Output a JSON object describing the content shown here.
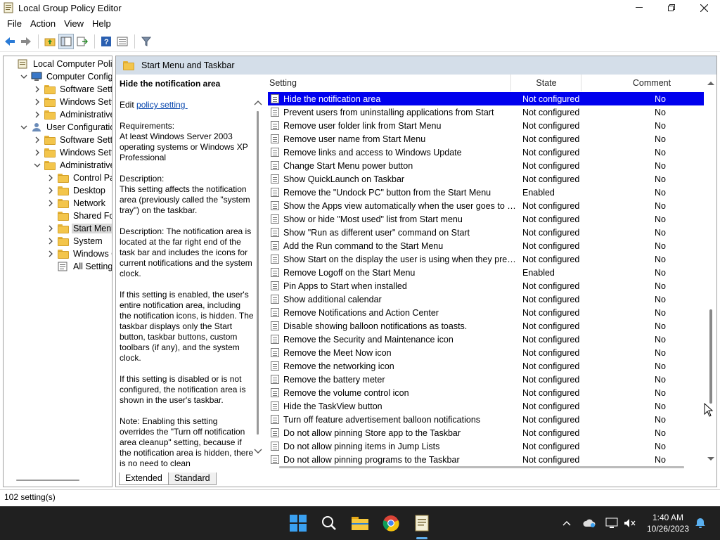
{
  "window": {
    "title": "Local Group Policy Editor"
  },
  "menu": [
    "File",
    "Action",
    "View",
    "Help"
  ],
  "tree": [
    {
      "label": "Local Computer Policy",
      "level": 0,
      "expander": "",
      "icon": "computer-policy-icon"
    },
    {
      "label": "Computer Configura",
      "level": 1,
      "expander": "open",
      "icon": "computer-icon"
    },
    {
      "label": "Software Settings",
      "level": 2,
      "expander": "closed",
      "icon": "folder-icon"
    },
    {
      "label": "Windows Setting",
      "level": 2,
      "expander": "closed",
      "icon": "folder-icon"
    },
    {
      "label": "Administrative Te",
      "level": 2,
      "expander": "closed",
      "icon": "folder-icon"
    },
    {
      "label": "User Configuration",
      "level": 1,
      "expander": "open",
      "icon": "user-icon"
    },
    {
      "label": "Software Settings",
      "level": 2,
      "expander": "closed",
      "icon": "folder-icon"
    },
    {
      "label": "Windows Setting",
      "level": 2,
      "expander": "closed",
      "icon": "folder-icon"
    },
    {
      "label": "Administrative Te",
      "level": 2,
      "expander": "open",
      "icon": "folder-icon"
    },
    {
      "label": "Control Panel",
      "level": 3,
      "expander": "closed",
      "icon": "folder-icon"
    },
    {
      "label": "Desktop",
      "level": 3,
      "expander": "closed",
      "icon": "folder-icon"
    },
    {
      "label": "Network",
      "level": 3,
      "expander": "closed",
      "icon": "folder-icon"
    },
    {
      "label": "Shared Folder",
      "level": 3,
      "expander": "",
      "icon": "folder-icon"
    },
    {
      "label": "Start Menu ar",
      "level": 3,
      "expander": "closed",
      "icon": "folder-icon",
      "selected": true
    },
    {
      "label": "System",
      "level": 3,
      "expander": "closed",
      "icon": "folder-icon"
    },
    {
      "label": "Windows Cor",
      "level": 3,
      "expander": "closed",
      "icon": "folder-icon"
    },
    {
      "label": "All Settings",
      "level": 3,
      "expander": "",
      "icon": "all-settings-icon"
    }
  ],
  "pane": {
    "title": "Start Menu and Taskbar"
  },
  "description": {
    "title": "Hide the notification area",
    "edit_prefix": "Edit ",
    "edit_link": "policy setting ",
    "paragraphs": [
      "Requirements:\nAt least Windows Server 2003 operating systems or Windows XP Professional",
      "Description:\nThis setting affects the notification area (previously called the \"system tray\") on the taskbar.",
      "Description: The notification area is located at the far right end of the task bar and includes the icons for current notifications and the system clock.",
      "If this setting is enabled, the user's entire notification area, including the notification icons, is hidden. The taskbar displays only the Start button, taskbar buttons, custom toolbars (if any), and the system clock.",
      "If this setting is disabled or is not configured, the notification area is shown in the user's taskbar.",
      "Note: Enabling this setting overrides the \"Turn off notification area cleanup\" setting, because if the notification area is hidden, there is no need to clean"
    ]
  },
  "table": {
    "headers": {
      "setting": "Setting",
      "state": "State",
      "comment": "Comment"
    },
    "rows": [
      {
        "setting": "Hide the notification area",
        "state": "Not configured",
        "comment": "No",
        "selected": true
      },
      {
        "setting": "Prevent users from uninstalling applications from Start",
        "state": "Not configured",
        "comment": "No"
      },
      {
        "setting": "Remove user folder link from Start Menu",
        "state": "Not configured",
        "comment": "No"
      },
      {
        "setting": "Remove user name from Start Menu",
        "state": "Not configured",
        "comment": "No"
      },
      {
        "setting": "Remove links and access to Windows Update",
        "state": "Not configured",
        "comment": "No"
      },
      {
        "setting": "Change Start Menu power button",
        "state": "Not configured",
        "comment": "No"
      },
      {
        "setting": "Show QuickLaunch on Taskbar",
        "state": "Not configured",
        "comment": "No"
      },
      {
        "setting": "Remove the \"Undock PC\" button from the Start Menu",
        "state": "Enabled",
        "comment": "No"
      },
      {
        "setting": "Show the Apps view automatically when the user goes to St...",
        "state": "Not configured",
        "comment": "No"
      },
      {
        "setting": "Show or hide \"Most used\" list from Start menu",
        "state": "Not configured",
        "comment": "No"
      },
      {
        "setting": "Show \"Run as different user\" command on Start",
        "state": "Not configured",
        "comment": "No"
      },
      {
        "setting": "Add the Run command to the Start Menu",
        "state": "Not configured",
        "comment": "No"
      },
      {
        "setting": "Show Start on the display the user is using when they press t...",
        "state": "Not configured",
        "comment": "No"
      },
      {
        "setting": "Remove Logoff on the Start Menu",
        "state": "Enabled",
        "comment": "No"
      },
      {
        "setting": "Pin Apps to Start when installed",
        "state": "Not configured",
        "comment": "No"
      },
      {
        "setting": "Show additional calendar",
        "state": "Not configured",
        "comment": "No"
      },
      {
        "setting": "Remove Notifications and Action Center",
        "state": "Not configured",
        "comment": "No"
      },
      {
        "setting": "Disable showing balloon notifications as toasts.",
        "state": "Not configured",
        "comment": "No"
      },
      {
        "setting": "Remove the Security and Maintenance icon",
        "state": "Not configured",
        "comment": "No"
      },
      {
        "setting": "Remove the Meet Now icon",
        "state": "Not configured",
        "comment": "No"
      },
      {
        "setting": "Remove the networking icon",
        "state": "Not configured",
        "comment": "No"
      },
      {
        "setting": "Remove the battery meter",
        "state": "Not configured",
        "comment": "No"
      },
      {
        "setting": "Remove the volume control icon",
        "state": "Not configured",
        "comment": "No"
      },
      {
        "setting": "Hide the TaskView button",
        "state": "Not configured",
        "comment": "No"
      },
      {
        "setting": "Turn off feature advertisement balloon notifications",
        "state": "Not configured",
        "comment": "No"
      },
      {
        "setting": "Do not allow pinning Store app to the Taskbar",
        "state": "Not configured",
        "comment": "No"
      },
      {
        "setting": "Do not allow pinning items in Jump Lists",
        "state": "Not configured",
        "comment": "No"
      },
      {
        "setting": "Do not allow pinning programs to the Taskbar",
        "state": "Not configured",
        "comment": "No"
      }
    ]
  },
  "tabs": [
    "Extended",
    "Standard"
  ],
  "status": {
    "text": "102 setting(s)"
  },
  "clock": {
    "time": "1:40 AM",
    "date": "10/26/2023"
  },
  "colors": {
    "selection": "#0000ee",
    "header_band": "#d4dee9",
    "taskbar": "#202020",
    "link": "#0645ad"
  }
}
